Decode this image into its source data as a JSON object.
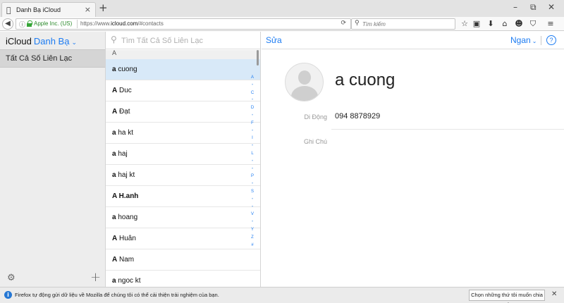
{
  "browser": {
    "tab": {
      "favicon": "apple-icon",
      "title": "Danh Bạ iCloud",
      "close": "×"
    },
    "new_tab": "+",
    "window": {
      "minimize": "–",
      "restore": "⧉",
      "close": "✕"
    },
    "url_bar": {
      "info_icon": "ⓘ",
      "org": "Apple Inc. (US)",
      "url_prefix": "https://www.",
      "url_host": "icloud.com",
      "url_path": "/#contacts",
      "reload": "⟳"
    },
    "search": {
      "placeholder": "Tìm kiếm"
    },
    "toolbar_icons": [
      "star-icon",
      "reading-list-icon",
      "download-icon",
      "home-icon",
      "pocket-icon",
      "shield-icon",
      "menu-icon"
    ],
    "toolbar_glyphs": [
      "☆",
      "▣",
      "⬇",
      "⌂",
      "☻",
      "⛉",
      "≡"
    ]
  },
  "sidebar": {
    "brand": "iCloud",
    "app_name": "Danh Bạ",
    "chevron": "⌄",
    "all_contacts": "Tất Cả Số Liên Lạc",
    "settings_glyph": "⚙",
    "add_glyph": "+"
  },
  "list": {
    "search_placeholder": "Tìm Tất Cả Số Liên Lạc",
    "section": "A",
    "contacts": [
      {
        "first": "a",
        "rest": " cuong",
        "selected": true
      },
      {
        "first": "A",
        "rest": " Duc",
        "selected": false
      },
      {
        "first": "A",
        "rest": " Đạt",
        "selected": false
      },
      {
        "first": "a",
        "rest": " ha kt",
        "selected": false
      },
      {
        "first": "a",
        "rest": " haj",
        "selected": false
      },
      {
        "first": "a",
        "rest": " haj kt",
        "selected": false
      },
      {
        "first": "A",
        "rest": " H.anh",
        "selected": false,
        "all_bold": true
      },
      {
        "first": "a",
        "rest": " hoang",
        "selected": false
      },
      {
        "first": "A",
        "rest": " Huân",
        "selected": false
      },
      {
        "first": "A",
        "rest": " Nam",
        "selected": false
      },
      {
        "first": "a",
        "rest": " ngoc kt",
        "selected": false
      }
    ],
    "index": [
      "A",
      "•",
      "C",
      "•",
      "D",
      "•",
      "F",
      "•",
      "I",
      "•",
      "L",
      "•",
      "•",
      "P",
      "•",
      "S",
      "•",
      "•",
      "V",
      "•",
      "Y",
      "Z",
      "#"
    ]
  },
  "detail": {
    "edit": "Sửa",
    "user": "Ngan",
    "user_chevron": "⌄",
    "help": "?",
    "name": "a cuong",
    "fields": [
      {
        "label": "Di Động",
        "value": "094 8878929"
      },
      {
        "label": "Ghi Chú",
        "value": ""
      }
    ]
  },
  "notification": {
    "icon": "i",
    "message": "Firefox tự động gửi dữ liệu về Mozilla để chúng tôi có thể cải thiện trải nghiệm của bạn.",
    "button": "Chọn những thứ tôi muốn chia sẻ",
    "close": "✕"
  }
}
